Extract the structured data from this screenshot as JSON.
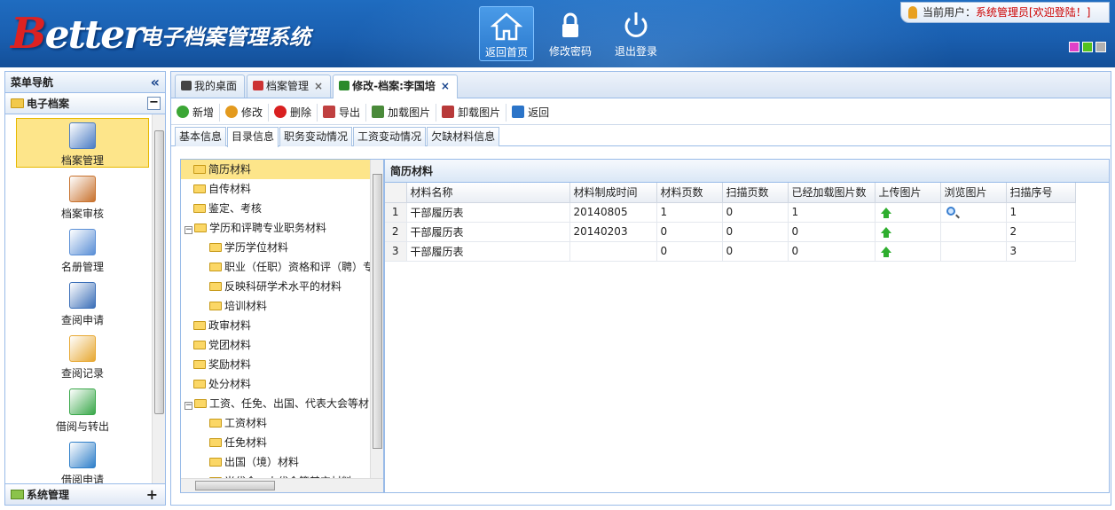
{
  "header": {
    "logo_text": "Better",
    "system_title": "电子档案管理系统",
    "nav": [
      {
        "label": "返回首页",
        "icon": "home-icon",
        "active": true
      },
      {
        "label": "修改密码",
        "icon": "lock-icon",
        "active": false
      },
      {
        "label": "退出登录",
        "icon": "power-icon",
        "active": false
      }
    ],
    "user_label": "当前用户：",
    "user_name": "系统管理员",
    "welcome": "[欢迎登陆！]",
    "skin_colors": [
      "#e040c8",
      "#54c21e",
      "#b0b0b0"
    ]
  },
  "sidebar": {
    "title": "菜单导航",
    "collapse_icon": "«",
    "section": "电子档案",
    "section_toggle": "−",
    "items": [
      {
        "label": "档案管理",
        "icon": "archive-manage-icon",
        "color": "#4a7cc4",
        "selected": true
      },
      {
        "label": "档案审核",
        "icon": "archive-audit-icon",
        "color": "#c8722e",
        "selected": false
      },
      {
        "label": "名册管理",
        "icon": "roster-icon",
        "color": "#5a8fd6",
        "selected": false
      },
      {
        "label": "查阅申请",
        "icon": "lookup-request-icon",
        "color": "#3b6fb8",
        "selected": false
      },
      {
        "label": "查阅记录",
        "icon": "lookup-record-icon",
        "color": "#e7a832",
        "selected": false
      },
      {
        "label": "借阅与转出",
        "icon": "borrow-transfer-icon",
        "color": "#3aa84a",
        "selected": false
      },
      {
        "label": "借阅申请",
        "icon": "borrow-request-icon",
        "color": "#2f7fc9",
        "selected": false
      }
    ],
    "footer": "系统管理",
    "footer_toggle": "+"
  },
  "tabs": [
    {
      "label": "我的桌面",
      "icon": "home-icon",
      "closable": false,
      "active": false
    },
    {
      "label": "档案管理",
      "icon": "document-icon",
      "closable": true,
      "active": false
    },
    {
      "label": "修改-档案:李国培",
      "icon": "pencil-icon",
      "closable": true,
      "active": true
    }
  ],
  "toolbar": [
    {
      "label": "新增",
      "icon": "add-icon",
      "color": "#3ba635"
    },
    {
      "label": "修改",
      "icon": "edit-icon",
      "color": "#e39a1e"
    },
    {
      "label": "删除",
      "icon": "delete-icon",
      "color": "#d92020"
    },
    {
      "label": "导出",
      "icon": "export-icon",
      "color": "#c04040"
    },
    {
      "label": "加载图片",
      "icon": "load-image-icon",
      "color": "#4a8a3a"
    },
    {
      "label": "卸载图片",
      "icon": "unload-image-icon",
      "color": "#b83a3a"
    },
    {
      "label": "返回",
      "icon": "back-icon",
      "color": "#2b74c8"
    }
  ],
  "subtabs": [
    "基本信息",
    "目录信息",
    "职务变动情况",
    "工资变动情况",
    "欠缺材料信息"
  ],
  "subtab_active": 1,
  "tree": [
    {
      "label": "简历材料",
      "level": 0,
      "selected": true,
      "expander": ""
    },
    {
      "label": "自传材料",
      "level": 0,
      "selected": false,
      "expander": ""
    },
    {
      "label": "鉴定、考核",
      "level": 0,
      "selected": false,
      "expander": ""
    },
    {
      "label": "学历和评聘专业职务材料",
      "level": 0,
      "selected": false,
      "expander": "−"
    },
    {
      "label": "学历学位材料",
      "level": 1,
      "selected": false,
      "expander": ""
    },
    {
      "label": "职业（任职）资格和评（聘）专",
      "level": 1,
      "selected": false,
      "expander": ""
    },
    {
      "label": "反映科研学术水平的材料",
      "level": 1,
      "selected": false,
      "expander": ""
    },
    {
      "label": "培训材料",
      "level": 1,
      "selected": false,
      "expander": ""
    },
    {
      "label": "政审材料",
      "level": 0,
      "selected": false,
      "expander": ""
    },
    {
      "label": "党团材料",
      "level": 0,
      "selected": false,
      "expander": ""
    },
    {
      "label": "奖励材料",
      "level": 0,
      "selected": false,
      "expander": ""
    },
    {
      "label": "处分材料",
      "level": 0,
      "selected": false,
      "expander": ""
    },
    {
      "label": "工资、任免、出国、代表大会等材",
      "level": 0,
      "selected": false,
      "expander": "−"
    },
    {
      "label": "工资材料",
      "level": 1,
      "selected": false,
      "expander": ""
    },
    {
      "label": "任免材料",
      "level": 1,
      "selected": false,
      "expander": ""
    },
    {
      "label": "出国（境）材料",
      "level": 1,
      "selected": false,
      "expander": ""
    },
    {
      "label": "当代会、人代会等其它材料",
      "level": 1,
      "selected": false,
      "expander": ""
    }
  ],
  "grid": {
    "title": "简历材料",
    "columns": [
      "材料名称",
      "材料制成时间",
      "材料页数",
      "扫描页数",
      "已经加载图片数",
      "上传图片",
      "浏览图片",
      "扫描序号"
    ],
    "rows": [
      {
        "num": "1",
        "name": "干部履历表",
        "date": "20140805",
        "pages": "1",
        "scanned": "0",
        "loaded": "1",
        "upload": true,
        "browse": true,
        "seq": "1"
      },
      {
        "num": "2",
        "name": "干部履历表",
        "date": "20140203",
        "pages": "0",
        "scanned": "0",
        "loaded": "0",
        "upload": true,
        "browse": false,
        "seq": "2"
      },
      {
        "num": "3",
        "name": "干部履历表",
        "date": "",
        "pages": "0",
        "scanned": "0",
        "loaded": "0",
        "upload": true,
        "browse": false,
        "seq": "3"
      }
    ]
  }
}
